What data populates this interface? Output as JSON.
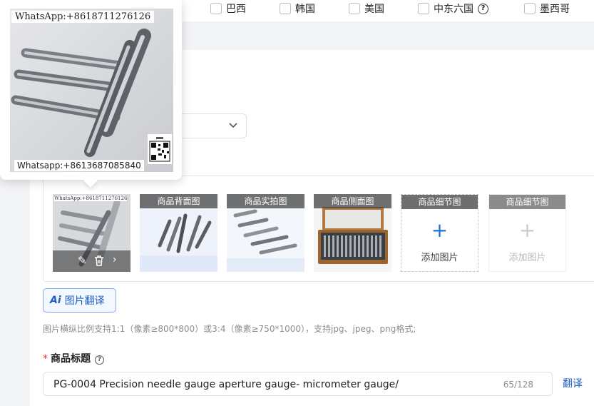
{
  "regions": [
    {
      "label": "巴西"
    },
    {
      "label": "韩国"
    },
    {
      "label": "美国"
    },
    {
      "label": "中东六国",
      "has_help": true
    },
    {
      "label": "墨西哥"
    }
  ],
  "popup": {
    "watermark_top": "WhatsApp:+8618711276126",
    "watermark_bottom": "Whatsapp:+8613687085840"
  },
  "image_slots": [
    {
      "label": "",
      "state": "filled",
      "mini_watermark": "WhatsApp:+8618711276126"
    },
    {
      "label": "商品背面图",
      "state": "filled"
    },
    {
      "label": "商品实拍图",
      "state": "filled"
    },
    {
      "label": "商品侧面图",
      "state": "filled"
    },
    {
      "label": "商品细节图",
      "state": "empty",
      "add_text": "添加图片"
    },
    {
      "label": "商品细节图",
      "state": "disabled",
      "add_text": "添加图片"
    }
  ],
  "ai_translate": {
    "mark": "Ai",
    "label": "图片翻译"
  },
  "image_hint": "图片横纵比例支持1:1（像素≥800*800）或3:4（像素≥750*1000），支持jpg、jpeg、png格式;",
  "title_field": {
    "required_mark": "*",
    "label": "商品标题",
    "value": "PG-0004 Precision needle gauge  aperture gauge- micrometer gauge/",
    "count": "65/128",
    "translate_label": "翻译"
  },
  "colors": {
    "accent": "#1f5fc4",
    "required": "#e33333"
  }
}
